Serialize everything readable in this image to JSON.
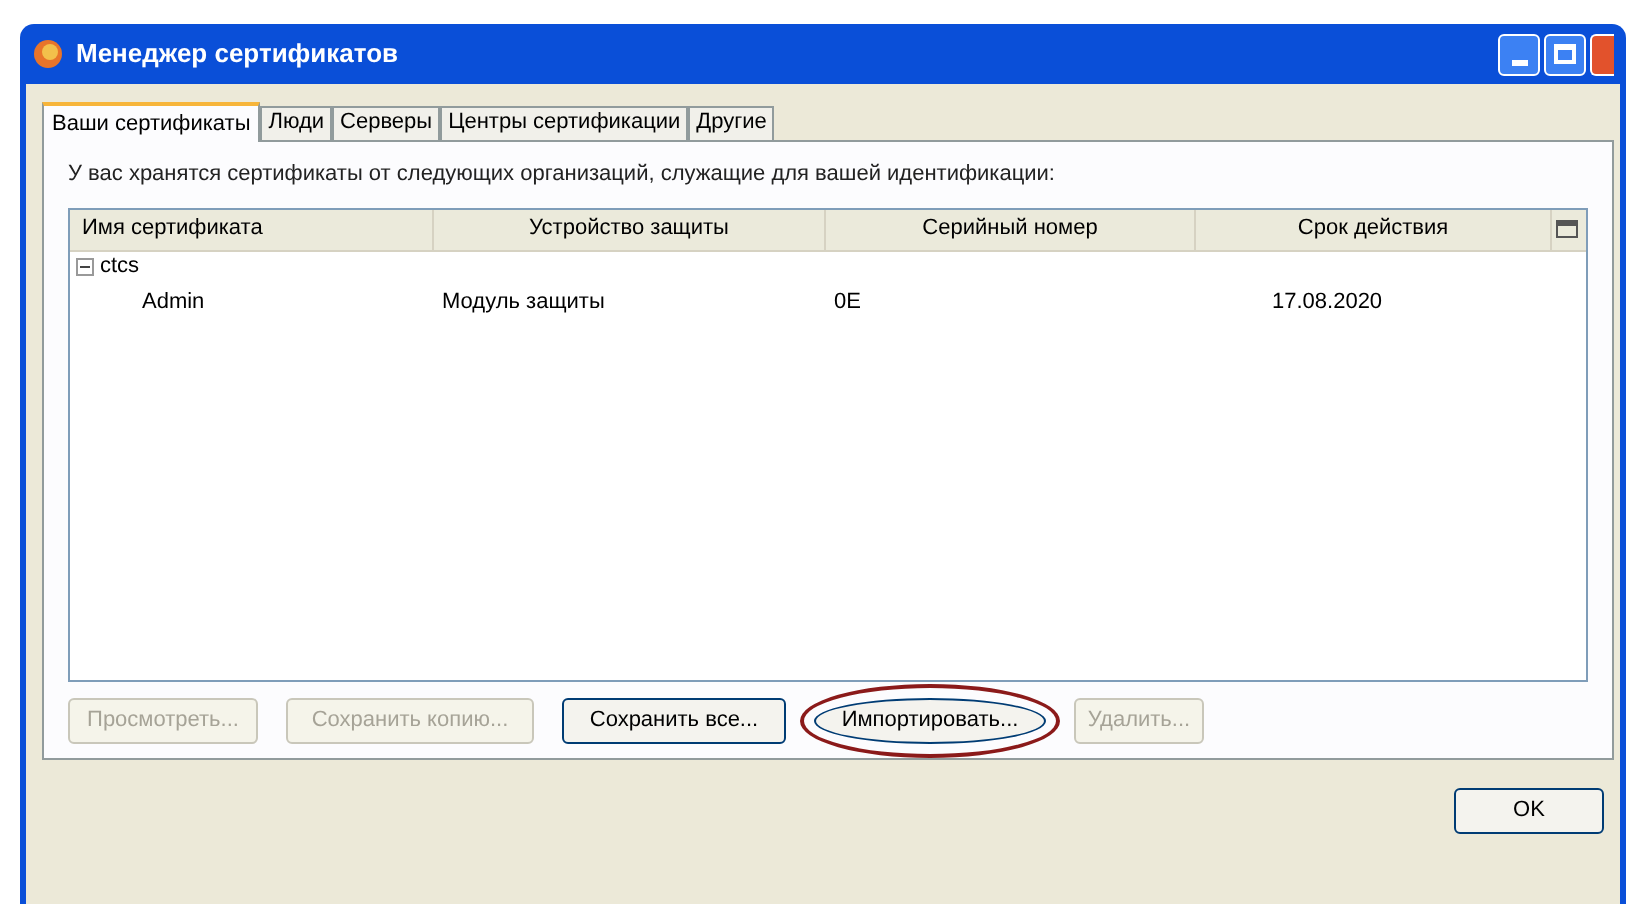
{
  "window": {
    "title": "Менеджер сертификатов"
  },
  "tabs": [
    {
      "label": "Ваши сертификаты",
      "selected": true
    },
    {
      "label": "Люди",
      "selected": false
    },
    {
      "label": "Серверы",
      "selected": false
    },
    {
      "label": "Центры сертификации",
      "selected": false
    },
    {
      "label": "Другие",
      "selected": false
    }
  ],
  "description": "У вас хранятся сертификаты от следующих организаций, служащие для вашей идентификации:",
  "table": {
    "columns": [
      "Имя сертификата",
      "Устройство защиты",
      "Серийный номер",
      "Срок действия"
    ],
    "groups": [
      {
        "name": "ctcs",
        "expanded": true,
        "rows": [
          [
            "Admin",
            "Модуль защиты",
            "0E",
            "17.08.2020"
          ]
        ]
      }
    ]
  },
  "buttons": [
    {
      "label": "Просмотреть...",
      "disabled": true,
      "highlighted": false
    },
    {
      "label": "Сохранить копию...",
      "disabled": true,
      "highlighted": false
    },
    {
      "label": "Сохранить все...",
      "disabled": false,
      "highlighted": false
    },
    {
      "label": "Импортировать...",
      "disabled": false,
      "highlighted": true
    },
    {
      "label": "Удалить...",
      "disabled": true,
      "highlighted": false
    }
  ],
  "ok_button": "OK"
}
